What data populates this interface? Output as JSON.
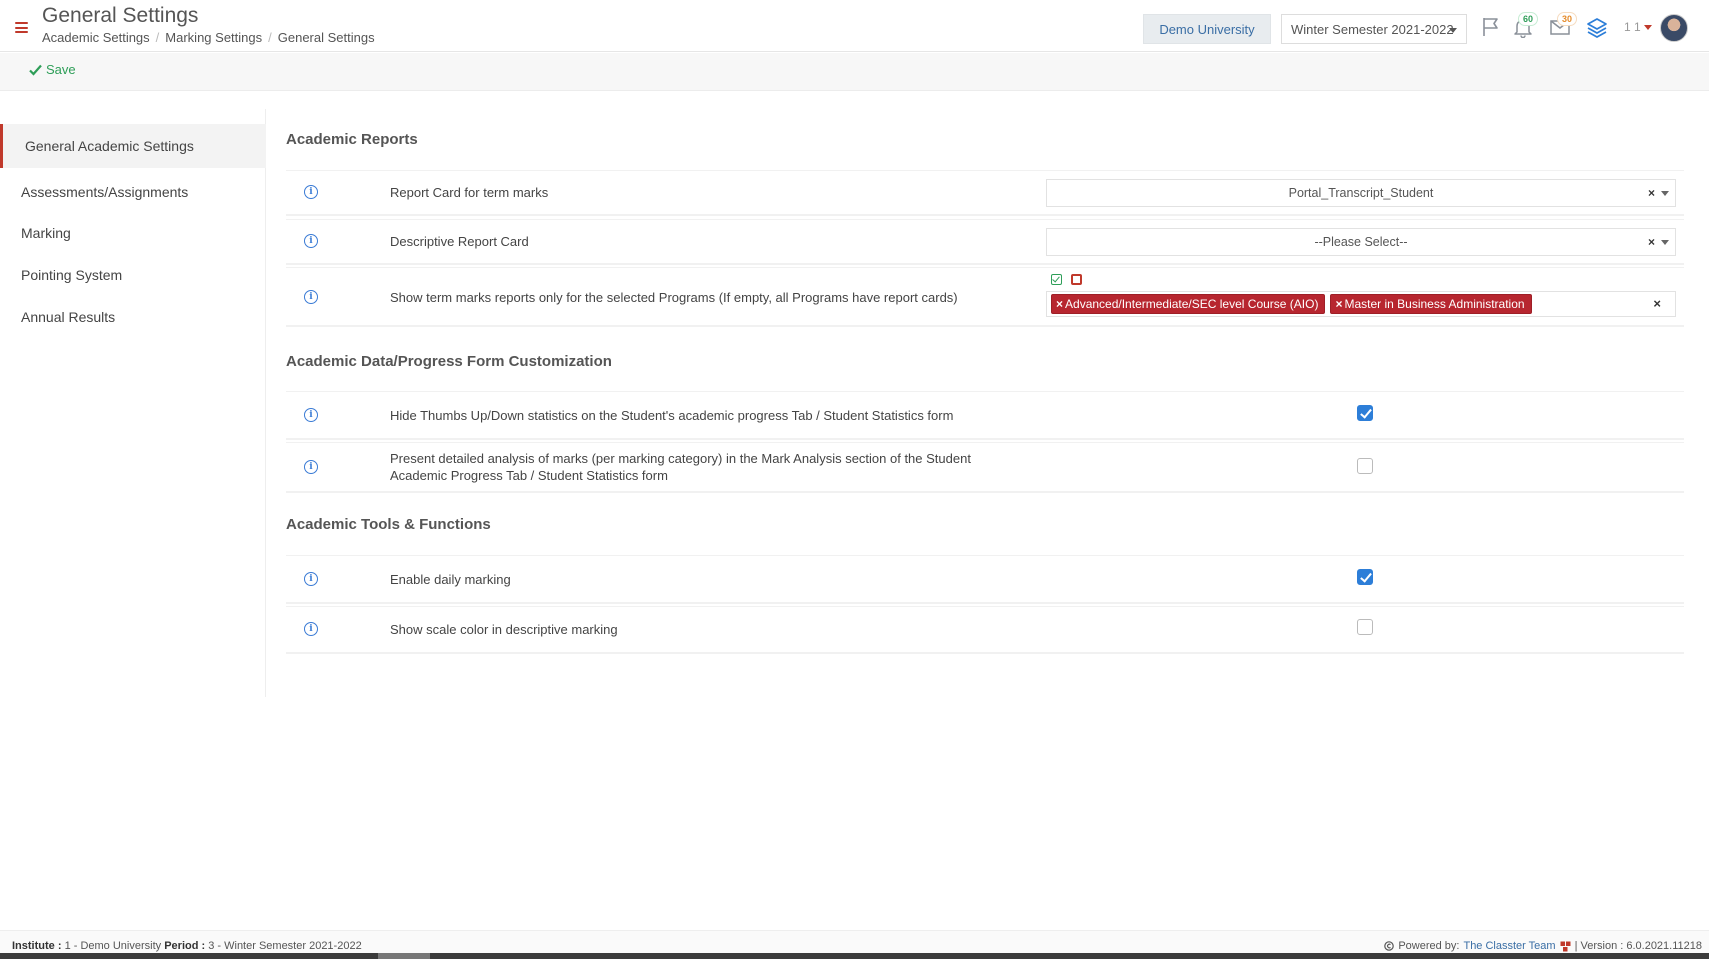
{
  "header": {
    "title": "General Settings",
    "breadcrumb": [
      "Academic Settings",
      "Marking Settings",
      "General Settings"
    ],
    "institute": "Demo University",
    "period": "Winter Semester 2021-2022",
    "notification_count": "60",
    "message_count": "30",
    "user_ids": "1 1"
  },
  "toolbar": {
    "save_label": "Save"
  },
  "sidebar": {
    "items": [
      {
        "label": "General Academic Settings"
      },
      {
        "label": "Assessments/Assignments"
      },
      {
        "label": "Marking"
      },
      {
        "label": "Pointing System"
      },
      {
        "label": "Annual Results"
      }
    ]
  },
  "sections": [
    {
      "title": "Academic Reports",
      "rows": [
        {
          "label": "Report Card for term marks",
          "value": "Portal_Transcript_Student"
        },
        {
          "label": "Descriptive Report Card",
          "value": "--Please Select--"
        },
        {
          "label": "Show term marks reports only for the selected Programs (If empty, all Programs have report cards)",
          "tags": [
            "Advanced/Intermediate/SEC level Course (AIO)",
            "Master in Business Administration"
          ]
        }
      ]
    },
    {
      "title": "Academic Data/Progress Form Customization",
      "rows": [
        {
          "label": "Hide Thumbs Up/Down statistics on the Student's academic progress Tab / Student Statistics form",
          "checked": true
        },
        {
          "label": "Present detailed analysis of marks (per marking category) in the Mark Analysis section of the Student Academic Progress Tab / Student Statistics form",
          "checked": false
        }
      ]
    },
    {
      "title": "Academic Tools & Functions",
      "rows": [
        {
          "label": "Enable daily marking",
          "checked": true
        },
        {
          "label": "Show scale color in descriptive marking",
          "checked": false
        }
      ]
    }
  ],
  "footer": {
    "institute_label": "Institute :",
    "institute_value": "1 - Demo University",
    "period_label": "Period :",
    "period_value": "3 - Winter Semester 2021-2022",
    "powered_by": "Powered by:",
    "team": "The Classter Team",
    "version": "| Version : 6.0.2021.11218"
  },
  "colors": {
    "accent": "#c0392b",
    "link": "#3a6ea5",
    "save": "#2e9e58",
    "checkbox": "#2d7ed8"
  }
}
